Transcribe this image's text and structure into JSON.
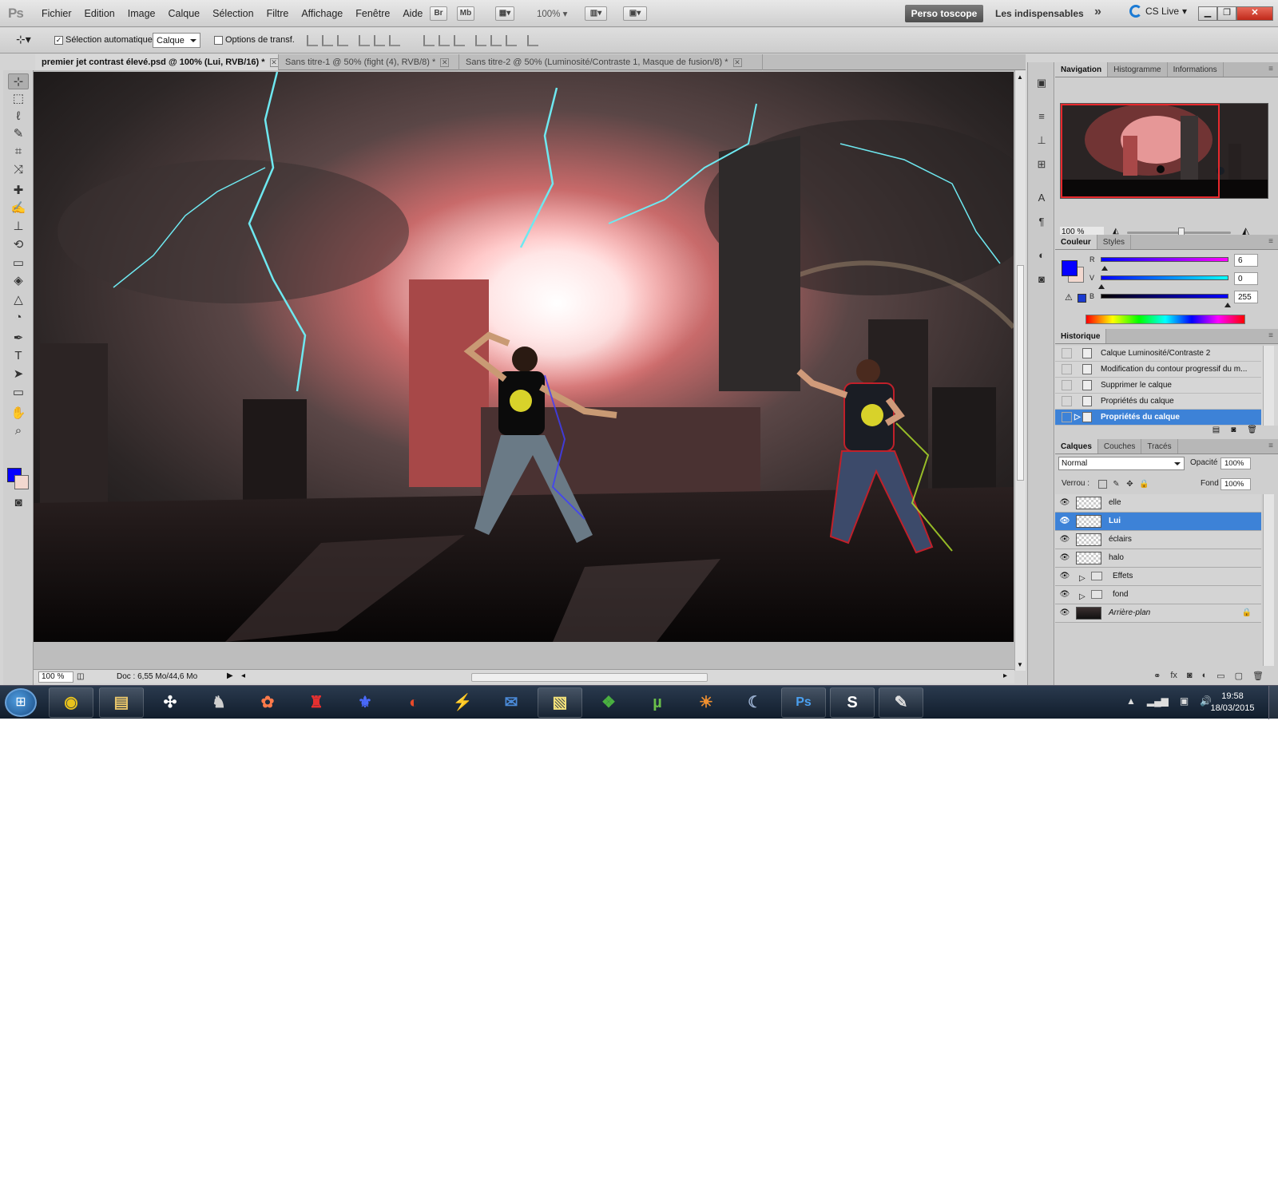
{
  "app": {
    "logo": "Ps"
  },
  "menu": [
    "Fichier",
    "Edition",
    "Image",
    "Calque",
    "Sélection",
    "Filtre",
    "Affichage",
    "Fenêtre",
    "Aide"
  ],
  "menubar": {
    "bridge": "Br",
    "mini_bridge": "Mb",
    "zoom": "100%",
    "workspace_active": "Perso toscope",
    "workspace": "Les indispensables",
    "more": "»",
    "cs_live": "CS Live"
  },
  "options": {
    "auto_select_label": "Sélection automatique :",
    "auto_select_checked": true,
    "auto_select_value": "Calque",
    "transform_label": "Options de transf."
  },
  "tabs": [
    {
      "label": "premier jet contrast élevé.psd @ 100% (Lui, RVB/16) *",
      "active": true
    },
    {
      "label": "Sans titre-1 @ 50% (fight (4), RVB/8) *",
      "active": false
    },
    {
      "label": "Sans titre-2 @ 50% (Luminosité/Contraste 1, Masque de fusion/8) *",
      "active": false
    }
  ],
  "status": {
    "zoom": "100 %",
    "doc": "Doc : 6,55 Mo/44,6 Mo"
  },
  "tools": [
    {
      "icon": "move-tool-icon",
      "glyph": "⊹"
    },
    {
      "icon": "marquee-tool-icon",
      "glyph": "⬚"
    },
    {
      "icon": "lasso-tool-icon",
      "glyph": "ℓ"
    },
    {
      "icon": "quick-select-tool-icon",
      "glyph": "✎"
    },
    {
      "icon": "crop-tool-icon",
      "glyph": "⌗"
    },
    {
      "icon": "eyedropper-tool-icon",
      "glyph": "⤨"
    },
    {
      "icon": "healing-brush-tool-icon",
      "glyph": "✚"
    },
    {
      "icon": "brush-tool-icon",
      "glyph": "✍"
    },
    {
      "icon": "stamp-tool-icon",
      "glyph": "⊥"
    },
    {
      "icon": "history-brush-tool-icon",
      "glyph": "⟲"
    },
    {
      "icon": "eraser-tool-icon",
      "glyph": "▭"
    },
    {
      "icon": "paint-bucket-tool-icon",
      "glyph": "◈"
    },
    {
      "icon": "blur-tool-icon",
      "glyph": "△"
    },
    {
      "icon": "dodge-tool-icon",
      "glyph": "◔"
    },
    {
      "icon": "pen-tool-icon",
      "glyph": "✒"
    },
    {
      "icon": "type-tool-icon",
      "glyph": "T"
    },
    {
      "icon": "path-select-tool-icon",
      "glyph": "➤"
    },
    {
      "icon": "shape-tool-icon",
      "glyph": "▭"
    },
    {
      "icon": "hand-tool-icon",
      "glyph": "✋"
    },
    {
      "icon": "zoom-tool-icon",
      "glyph": "⌕"
    }
  ],
  "navigator": {
    "tabs": [
      "Navigation",
      "Histogramme",
      "Informations"
    ],
    "zoom": "100 %"
  },
  "color": {
    "tabs": [
      "Couleur",
      "Styles"
    ],
    "channels": [
      {
        "label": "R",
        "value": "6"
      },
      {
        "label": "V",
        "value": "0"
      },
      {
        "label": "B",
        "value": "255"
      }
    ],
    "foreground": "#0600ff",
    "background": "#f2d8cf"
  },
  "history": {
    "tabs": [
      "Historique"
    ],
    "items": [
      {
        "label": "Calque Luminosité/Contraste 2",
        "selected": false
      },
      {
        "label": "Modification du contour progressif du m...",
        "selected": false
      },
      {
        "label": "Supprimer le calque",
        "selected": false
      },
      {
        "label": "Propriétés du calque",
        "selected": false
      },
      {
        "label": "Propriétés du calque",
        "selected": true
      }
    ]
  },
  "layers": {
    "tabs": [
      "Calques",
      "Couches",
      "Tracés"
    ],
    "blend_mode": "Normal",
    "opacity_label": "Opacité :",
    "opacity": "100%",
    "lock_label": "Verrou :",
    "fill_label": "Fond :",
    "fill": "100%",
    "items": [
      {
        "name": "elle",
        "type": "layer",
        "selected": false
      },
      {
        "name": "Lui",
        "type": "layer",
        "selected": true
      },
      {
        "name": "éclairs",
        "type": "layer",
        "selected": false
      },
      {
        "name": "halo",
        "type": "layer",
        "selected": false
      },
      {
        "name": "Effets",
        "type": "group",
        "selected": false
      },
      {
        "name": "fond",
        "type": "group",
        "selected": false
      },
      {
        "name": "Arrière-plan",
        "type": "background",
        "selected": false
      }
    ]
  },
  "taskbar": {
    "apps": [
      {
        "name": "chrome-icon",
        "glyph": "◉",
        "color": "#e8c21c"
      },
      {
        "name": "explorer-icon",
        "glyph": "▤",
        "color": "#e9c66b"
      },
      {
        "name": "app3-icon",
        "glyph": "✣",
        "color": "#ffffff"
      },
      {
        "name": "app4-icon",
        "glyph": "♞",
        "color": "#cfcfcf"
      },
      {
        "name": "app5-icon",
        "glyph": "✿",
        "color": "#ff7a4a"
      },
      {
        "name": "app6-icon",
        "glyph": "♜",
        "color": "#e43030"
      },
      {
        "name": "app7-icon",
        "glyph": "⚜",
        "color": "#4a6aff"
      },
      {
        "name": "app8-icon",
        "glyph": "◐",
        "color": "#e84a2a"
      },
      {
        "name": "winamp-icon",
        "glyph": "⚡",
        "color": "#f0b030"
      },
      {
        "name": "thunderbird-icon",
        "glyph": "✉",
        "color": "#4a8ad8"
      },
      {
        "name": "sticky-notes-icon",
        "glyph": "▧",
        "color": "#f5e37a"
      },
      {
        "name": "virtualbox-icon",
        "glyph": "❖",
        "color": "#4ab040"
      },
      {
        "name": "utorrent-icon",
        "glyph": "µ",
        "color": "#6ac04a"
      },
      {
        "name": "app14-icon",
        "glyph": "☀",
        "color": "#f09030"
      },
      {
        "name": "app15-icon",
        "glyph": "☾",
        "color": "#9ab0d0"
      },
      {
        "name": "photoshop-icon",
        "glyph": "Ps",
        "color": "#4aa0f0"
      },
      {
        "name": "skype-icon",
        "glyph": "S",
        "color": "#ffffff"
      },
      {
        "name": "paint-icon",
        "glyph": "✎",
        "color": "#e0e0e0"
      }
    ],
    "time": "19:58",
    "date": "18/03/2015"
  }
}
